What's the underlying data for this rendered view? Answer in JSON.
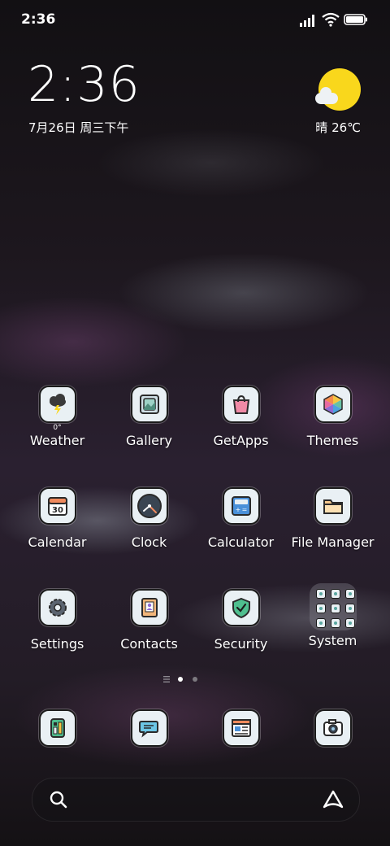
{
  "status_bar": {
    "time": "2:36"
  },
  "lock_widget": {
    "time": "2:36",
    "date": "7月26日 周三下午",
    "weather": "晴 26℃"
  },
  "apps": [
    {
      "label": "Weather",
      "icon": "weather-icon",
      "sub": "0°"
    },
    {
      "label": "Gallery",
      "icon": "gallery-icon"
    },
    {
      "label": "GetApps",
      "icon": "getapps-icon"
    },
    {
      "label": "Themes",
      "icon": "themes-icon"
    },
    {
      "label": "Calendar",
      "icon": "calendar-icon",
      "sub": "30"
    },
    {
      "label": "Clock",
      "icon": "clock-icon"
    },
    {
      "label": "Calculator",
      "icon": "calculator-icon"
    },
    {
      "label": "File Manager",
      "icon": "file-manager-icon"
    },
    {
      "label": "Settings",
      "icon": "settings-icon"
    },
    {
      "label": "Contacts",
      "icon": "contacts-icon"
    },
    {
      "label": "Security",
      "icon": "security-icon"
    },
    {
      "label": "System",
      "icon": "folder-icon"
    }
  ],
  "page_indicator": {
    "pages": 2,
    "active": 1
  },
  "dock": [
    {
      "icon": "phone-icon"
    },
    {
      "icon": "messages-icon"
    },
    {
      "icon": "browser-icon"
    },
    {
      "icon": "camera-icon"
    }
  ],
  "colors": {
    "accent_yellow": "#f9d71c",
    "icon_bg": "#e9f0f4"
  }
}
